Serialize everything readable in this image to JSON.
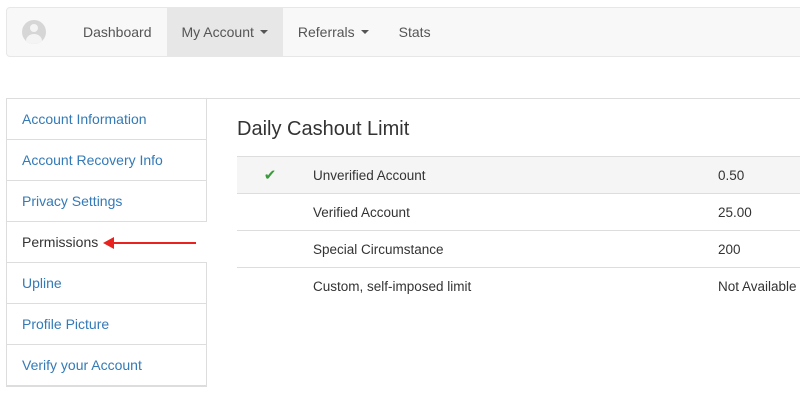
{
  "navbar": {
    "items": [
      {
        "label": "Dashboard",
        "dropdown": false,
        "active": false
      },
      {
        "label": "My Account",
        "dropdown": true,
        "active": true
      },
      {
        "label": "Referrals",
        "dropdown": true,
        "active": false
      },
      {
        "label": "Stats",
        "dropdown": false,
        "active": false
      }
    ]
  },
  "sidebar": {
    "items": [
      {
        "label": "Account Information"
      },
      {
        "label": "Account Recovery Info"
      },
      {
        "label": "Privacy Settings"
      },
      {
        "label": "Permissions",
        "active": true
      },
      {
        "label": "Upline"
      },
      {
        "label": "Profile Picture"
      },
      {
        "label": "Verify your Account"
      }
    ]
  },
  "main": {
    "title": "Daily Cashout Limit",
    "rows": [
      {
        "checked": true,
        "label": "Unverified Account",
        "value": "0.50"
      },
      {
        "checked": false,
        "label": "Verified Account",
        "value": "25.00"
      },
      {
        "checked": false,
        "label": "Special Circumstance",
        "value": "200"
      },
      {
        "checked": false,
        "label": "Custom, self-imposed limit",
        "value": "Not Available"
      }
    ]
  },
  "colors": {
    "link": "#337ab7",
    "check": "#3c9a3c",
    "annotation_arrow": "#e8231f"
  },
  "icons": {
    "avatar": "user-avatar-icon",
    "check": "checkmark-icon"
  }
}
